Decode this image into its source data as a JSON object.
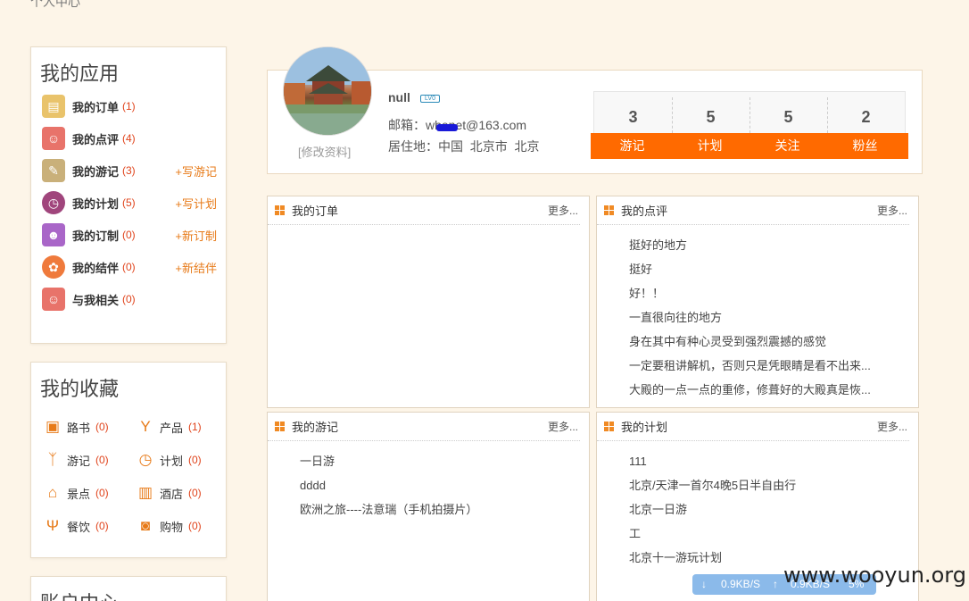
{
  "breadcrumb": "个人中心",
  "my_apps": {
    "title": "我的应用",
    "items": [
      {
        "name": "我的订单",
        "count": "(1)",
        "action": ""
      },
      {
        "name": "我的点评",
        "count": "(4)",
        "action": ""
      },
      {
        "name": "我的游记",
        "count": "(3)",
        "action": "+写游记"
      },
      {
        "name": "我的计划",
        "count": "(5)",
        "action": "+写计划"
      },
      {
        "name": "我的订制",
        "count": "(0)",
        "action": "+新订制"
      },
      {
        "name": "我的结伴",
        "count": "(0)",
        "action": "+新结伴"
      },
      {
        "name": "与我相关",
        "count": "(0)",
        "action": ""
      }
    ]
  },
  "my_favorites": {
    "title": "我的收藏",
    "items": [
      {
        "name": "路书",
        "count": "(0)"
      },
      {
        "name": "产品",
        "count": "(1)"
      },
      {
        "name": "游记",
        "count": "(0)"
      },
      {
        "name": "计划",
        "count": "(0)"
      },
      {
        "name": "景点",
        "count": "(0)"
      },
      {
        "name": "酒店",
        "count": "(0)"
      },
      {
        "name": "餐饮",
        "count": "(0)"
      },
      {
        "name": "购物",
        "count": "(0)"
      }
    ]
  },
  "account_center": {
    "title": "账户中心"
  },
  "profile": {
    "username": "null",
    "badge": "LV0",
    "email_label": "邮箱：",
    "email": "wbenet@163.com",
    "residence_label": "居住地：",
    "residence": "中国  北京市  北京",
    "edit_link": "[修改资料]",
    "stats": [
      {
        "value": "3",
        "label": "游记"
      },
      {
        "value": "5",
        "label": "计划"
      },
      {
        "value": "5",
        "label": "关注"
      },
      {
        "value": "2",
        "label": "粉丝"
      }
    ]
  },
  "panels": {
    "orders": {
      "title": "我的订单",
      "more": "更多...",
      "items": []
    },
    "reviews": {
      "title": "我的点评",
      "more": "更多...",
      "items": [
        "挺好的地方",
        "挺好",
        "好！！",
        "一直很向往的地方",
        "身在其中有种心灵受到强烈震撼的感觉",
        "一定要租讲解机，否则只是凭眼睛是看不出来...",
        "大殿的一点一点的重修，修葺好的大殿真是恢..."
      ]
    },
    "travelogues": {
      "title": "我的游记",
      "more": "更多...",
      "items": [
        "一日游",
        "dddd",
        "欧洲之旅----法意瑞（手机拍摄片）"
      ]
    },
    "plans": {
      "title": "我的计划",
      "more": "更多...",
      "items": [
        "111",
        "北京/天津一首尔4晚5日半自由行",
        "北京一日游",
        "工",
        "北京十一游玩计划"
      ]
    }
  },
  "watermark": "www.wooyun.org",
  "netbar": {
    "down": "0.9KB/S",
    "up": "0.9KB/S",
    "pct": "5%"
  },
  "colors": {
    "accent": "#ff6a00",
    "count": "#e0431b",
    "action": "#e77a18",
    "background": "#fdf5e8"
  }
}
